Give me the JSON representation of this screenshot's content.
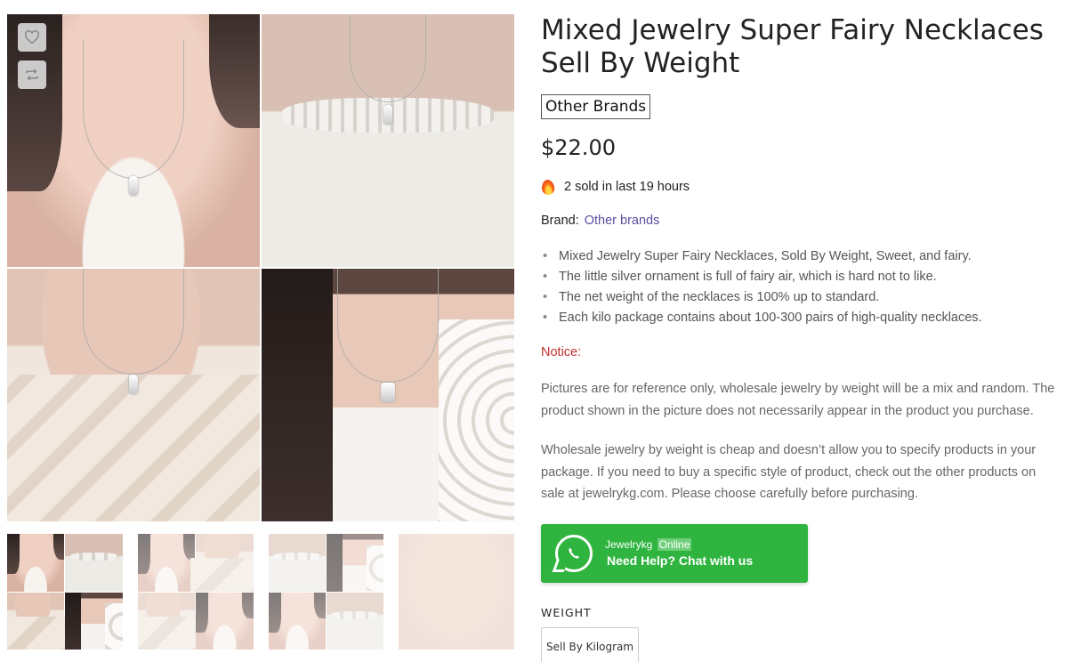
{
  "gallery": {
    "wishlist_icon": "heart-icon",
    "compare_icon": "compare-icon"
  },
  "product": {
    "title": "Mixed Jewelry Super Fairy Necklaces Sell By Weight",
    "brand_badge": "Other Brands",
    "price": "$22.00",
    "sold_text": "2 sold in last 19 hours",
    "brand_label": "Brand:",
    "brand_link": "Other brands",
    "features": [
      "Mixed Jewelry Super Fairy Necklaces, Sold By Weight, Sweet, and fairy.",
      "The little silver ornament is full of fairy air, which is hard not to like.",
      "The net weight of the necklaces is 100% up to standard.",
      "Each kilo package contains about 100-300 pairs of high-quality necklaces."
    ],
    "notice_label": "Notice:",
    "notice_text_1": "Pictures are for reference only, wholesale jewelry by weight will be a mix and random. The product shown in the picture does not necessarily appear in the product you purchase.",
    "notice_text_2": "Wholesale jewelry by weight is cheap and doesn’t allow you to specify products in your package. If you need to buy a specific style of product, check out the other products on sale at jewelrykg.com. Please choose carefully before purchasing."
  },
  "whatsapp": {
    "name": "Jewelrykg",
    "status": "Online",
    "cta": "Need Help? Chat with us",
    "color": "#2eb43f"
  },
  "weight": {
    "label": "WEIGHT",
    "selected": "Sell By Kilogram"
  },
  "colors": {
    "notice": "#c5312d",
    "link": "#5b4e9e"
  }
}
